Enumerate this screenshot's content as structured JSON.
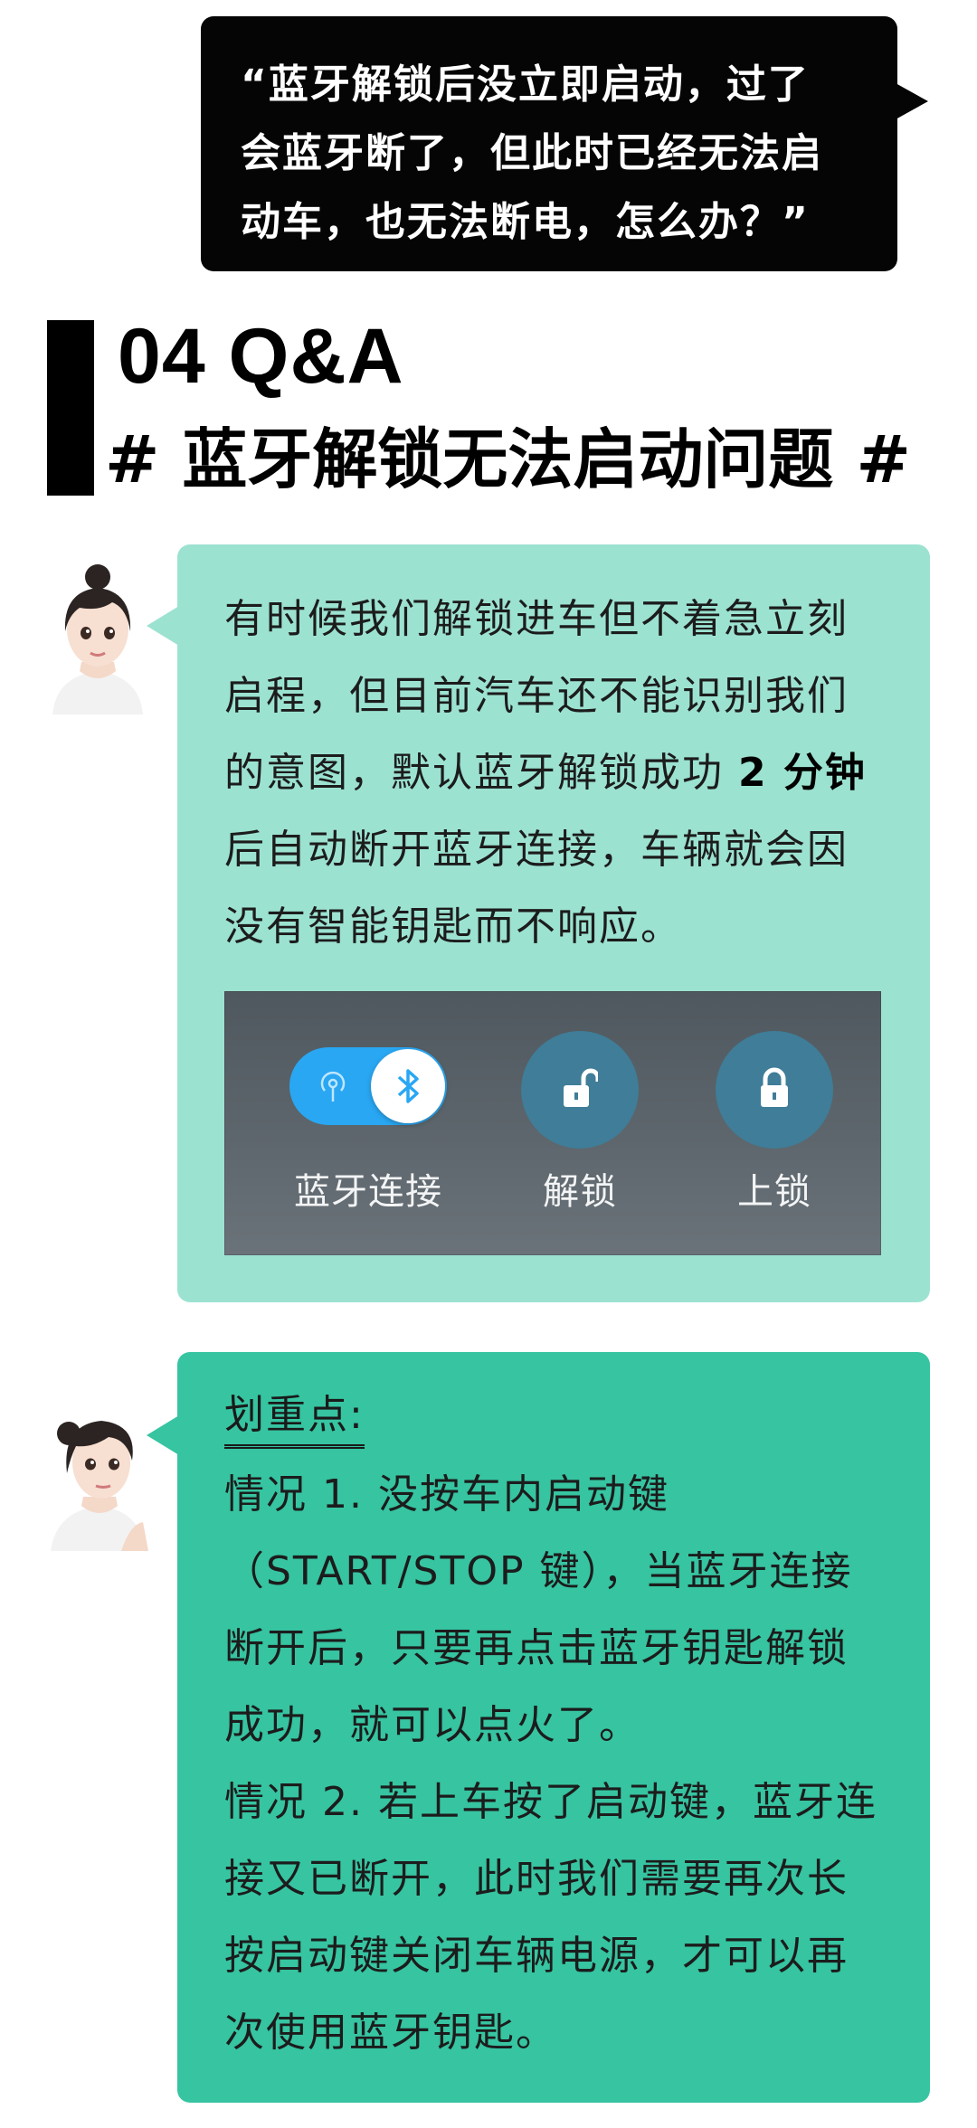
{
  "quote": {
    "text": "“蓝牙解锁后没立即启动，过了\n会蓝牙断了，但此时已经无法启\n动车，也无法断电，怎么办？”"
  },
  "section": {
    "number": "04 Q&A",
    "title": "# 蓝牙解锁无法启动问题 #"
  },
  "card1": {
    "text_before": "有时候我们解锁进车但不着急立刻启程，但目前汽车还不能识别我们的意图，默认蓝牙解锁成功 ",
    "text_bold": "2 分钟",
    "text_after": "后自动断开蓝牙连接，车辆就会因没有智能钥匙而不响应。",
    "panel": {
      "bt_label": "蓝牙连接",
      "unlock_label": "解锁",
      "lock_label": "上锁",
      "toggle_color": "#29a7f3",
      "button_color": "#3f7d98",
      "bluetooth_on": true
    }
  },
  "card2": {
    "title": "划重点:",
    "case1": "情况 1. 没按车内启动键（START/STOP 键），当蓝牙连接断开后，只要再点击蓝牙钥匙解锁成功，就可以点火了。",
    "case2": "情况 2. 若上车按了启动键，蓝牙连接又已断开，此时我们需要再次长按启动键关闭车辆电源，才可以再次使用蓝牙钥匙。"
  },
  "colors": {
    "quote_bg": "#050505",
    "card1_bg": "#9ce2d1",
    "card2_bg": "#36c4a1"
  }
}
